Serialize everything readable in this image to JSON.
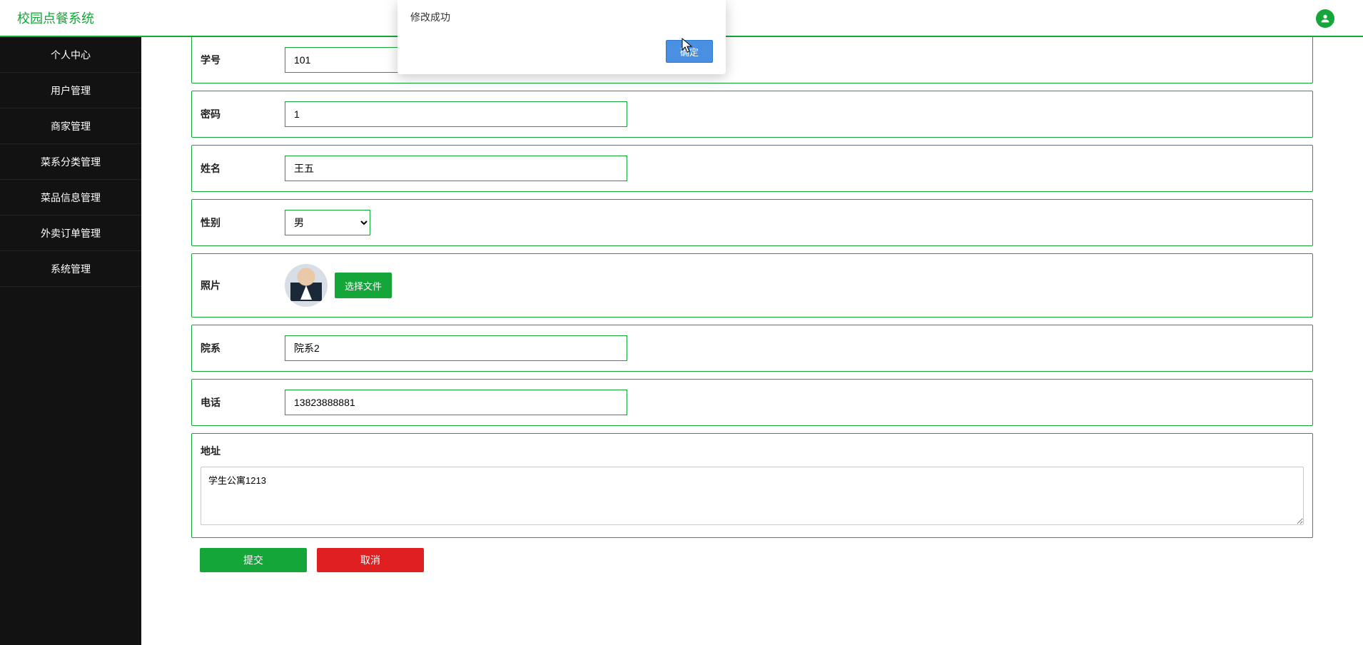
{
  "header": {
    "brand": "校园点餐系统"
  },
  "sidebar": {
    "items": [
      {
        "label": "个人中心"
      },
      {
        "label": "用户管理"
      },
      {
        "label": "商家管理"
      },
      {
        "label": "菜系分类管理"
      },
      {
        "label": "菜品信息管理"
      },
      {
        "label": "外卖订单管理"
      },
      {
        "label": "系统管理"
      }
    ]
  },
  "form": {
    "student_id": {
      "label": "学号",
      "value": "101"
    },
    "password": {
      "label": "密码",
      "value": "1"
    },
    "name": {
      "label": "姓名",
      "value": "王五"
    },
    "gender": {
      "label": "性别",
      "value": "男"
    },
    "photo": {
      "label": "照片",
      "choose_file_btn": "选择文件"
    },
    "faculty": {
      "label": "院系",
      "value": "院系2"
    },
    "phone": {
      "label": "电话",
      "value": "13823888881"
    },
    "address": {
      "label": "地址",
      "value": "学生公寓1213"
    }
  },
  "actions": {
    "submit": "提交",
    "cancel": "取消"
  },
  "modal": {
    "message": "修改成功",
    "confirm": "确定"
  }
}
